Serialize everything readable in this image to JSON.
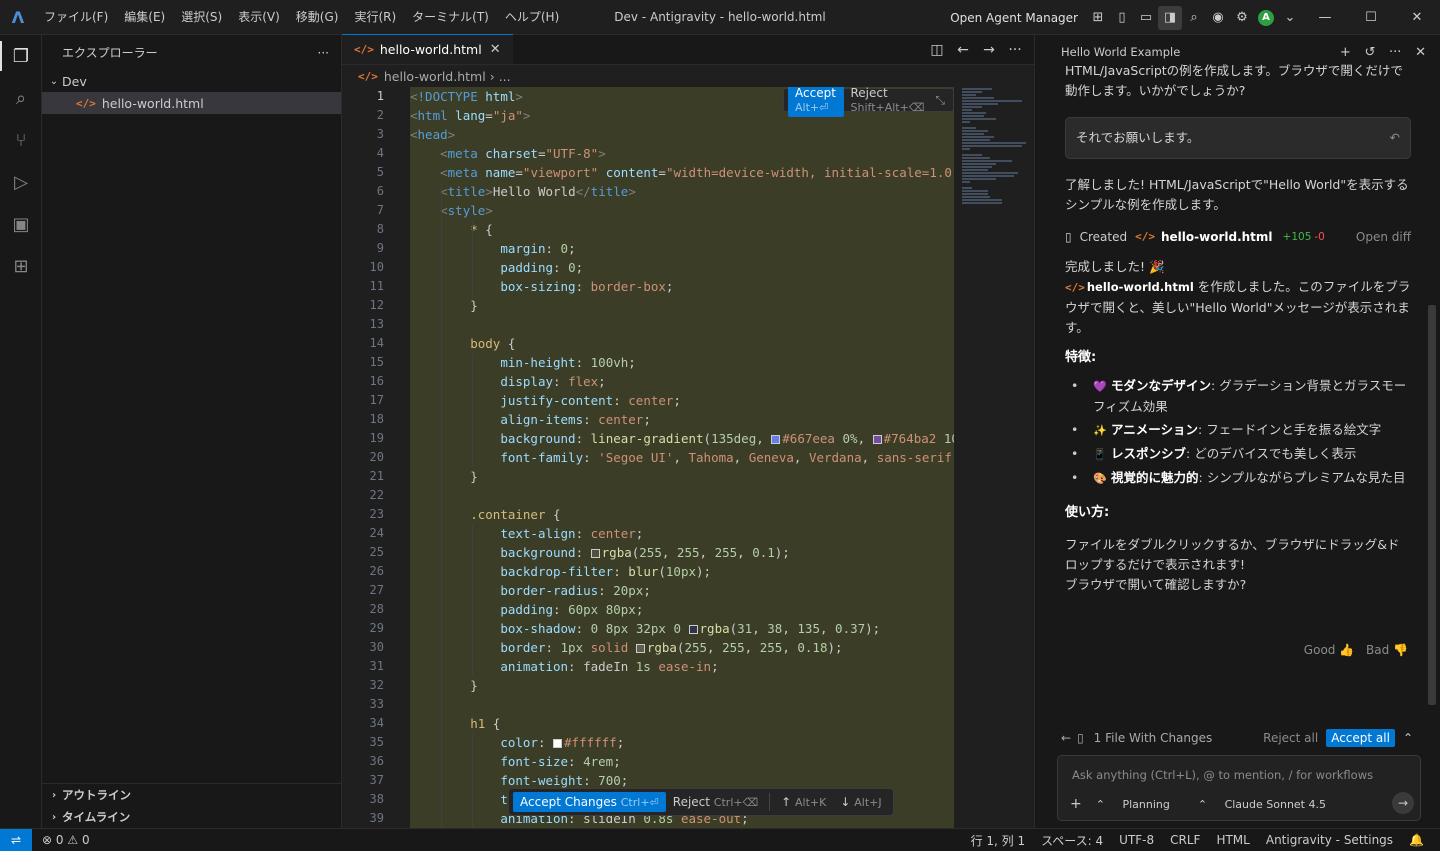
{
  "titlebar": {
    "menu": [
      "ファイル(F)",
      "編集(E)",
      "選択(S)",
      "表示(V)",
      "移動(G)",
      "実行(R)",
      "ターミナル(T)",
      "ヘルプ(H)"
    ],
    "window_title": "Dev - Antigravity - hello-world.html",
    "open_agent_manager": "Open Agent Manager",
    "avatar_letter": "A"
  },
  "sidebar": {
    "title": "エクスプローラー",
    "folder": "Dev",
    "file": "hello-world.html",
    "outline": "アウトライン",
    "timeline": "タイムライン"
  },
  "editor": {
    "tab_label": "hello-world.html",
    "breadcrumb_file": "hello-world.html",
    "breadcrumb_more": "...",
    "accept_label": "Accept",
    "accept_kb": "Alt+⏎",
    "reject_label": "Reject",
    "reject_kb": "Shift+Alt+⌫",
    "accept_changes_label": "Accept Changes",
    "accept_changes_kb": "Ctrl+⏎",
    "reject_changes_label": "Reject",
    "reject_changes_kb": "Ctrl+⌫",
    "prev_kb": "Alt+K",
    "next_kb": "Alt+J",
    "line_numbers": [
      "1",
      "2",
      "3",
      "4",
      "5",
      "6",
      "7",
      "8",
      "9",
      "10",
      "11",
      "12",
      "13",
      "14",
      "15",
      "16",
      "17",
      "18",
      "19",
      "20",
      "21",
      "22",
      "23",
      "24",
      "25",
      "26",
      "27",
      "28",
      "29",
      "30",
      "31",
      "32",
      "33",
      "34",
      "35",
      "36",
      "37",
      "38",
      "39"
    ]
  },
  "agent": {
    "title": "Hello World Example",
    "top_text": "HTML/JavaScriptの例を作成します。ブラウザで開くだけで動作します。いかがでしょうか?",
    "user_message": "それでお願いします。",
    "reply_intro": "了解しました! HTML/JavaScriptで\"Hello World\"を表示するシンプルな例を作成します。",
    "created_label": "Created",
    "created_file": "hello-world.html",
    "created_plus": "+105",
    "created_minus": "-0",
    "open_diff": "Open diff",
    "done_line": "完成しました! 🎉",
    "done_file": "hello-world.html",
    "done_text": "を作成しました。このファイルをブラウザで開くと、美しい\"Hello World\"メッセージが表示されます。",
    "features_heading": "特徴:",
    "features": [
      {
        "emoji": "💜",
        "title": "モダンなデザイン",
        "desc": ": グラデーション背景とガラスモーフィズム効果"
      },
      {
        "emoji": "✨",
        "title": "アニメーション",
        "desc": ": フェードインと手を振る絵文字"
      },
      {
        "emoji": "📱",
        "title": "レスポンシブ",
        "desc": ": どのデバイスでも美しく表示"
      },
      {
        "emoji": "🎨",
        "title": "視覚的に魅力的",
        "desc": ": シンプルながらプレミアムな見た目"
      }
    ],
    "usage_heading": "使い方:",
    "usage_text": "ファイルをダブルクリックするか、ブラウザにドラッグ&ドロップするだけで表示されます!",
    "usage_question": "ブラウザで開いて確認しますか?",
    "good": "Good",
    "bad": "Bad",
    "changes_label": "1 File With Changes",
    "reject_all": "Reject all",
    "accept_all": "Accept all",
    "input_placeholder": "Ask anything (Ctrl+L), @ to mention, / for workflows",
    "mode": "Planning",
    "model": "Claude Sonnet 4.5"
  },
  "status": {
    "errors": "0",
    "warnings": "0",
    "position": "行 1, 列 1",
    "spaces": "スペース: 4",
    "encoding": "UTF-8",
    "eol": "CRLF",
    "language": "HTML",
    "settings": "Antigravity - Settings"
  }
}
